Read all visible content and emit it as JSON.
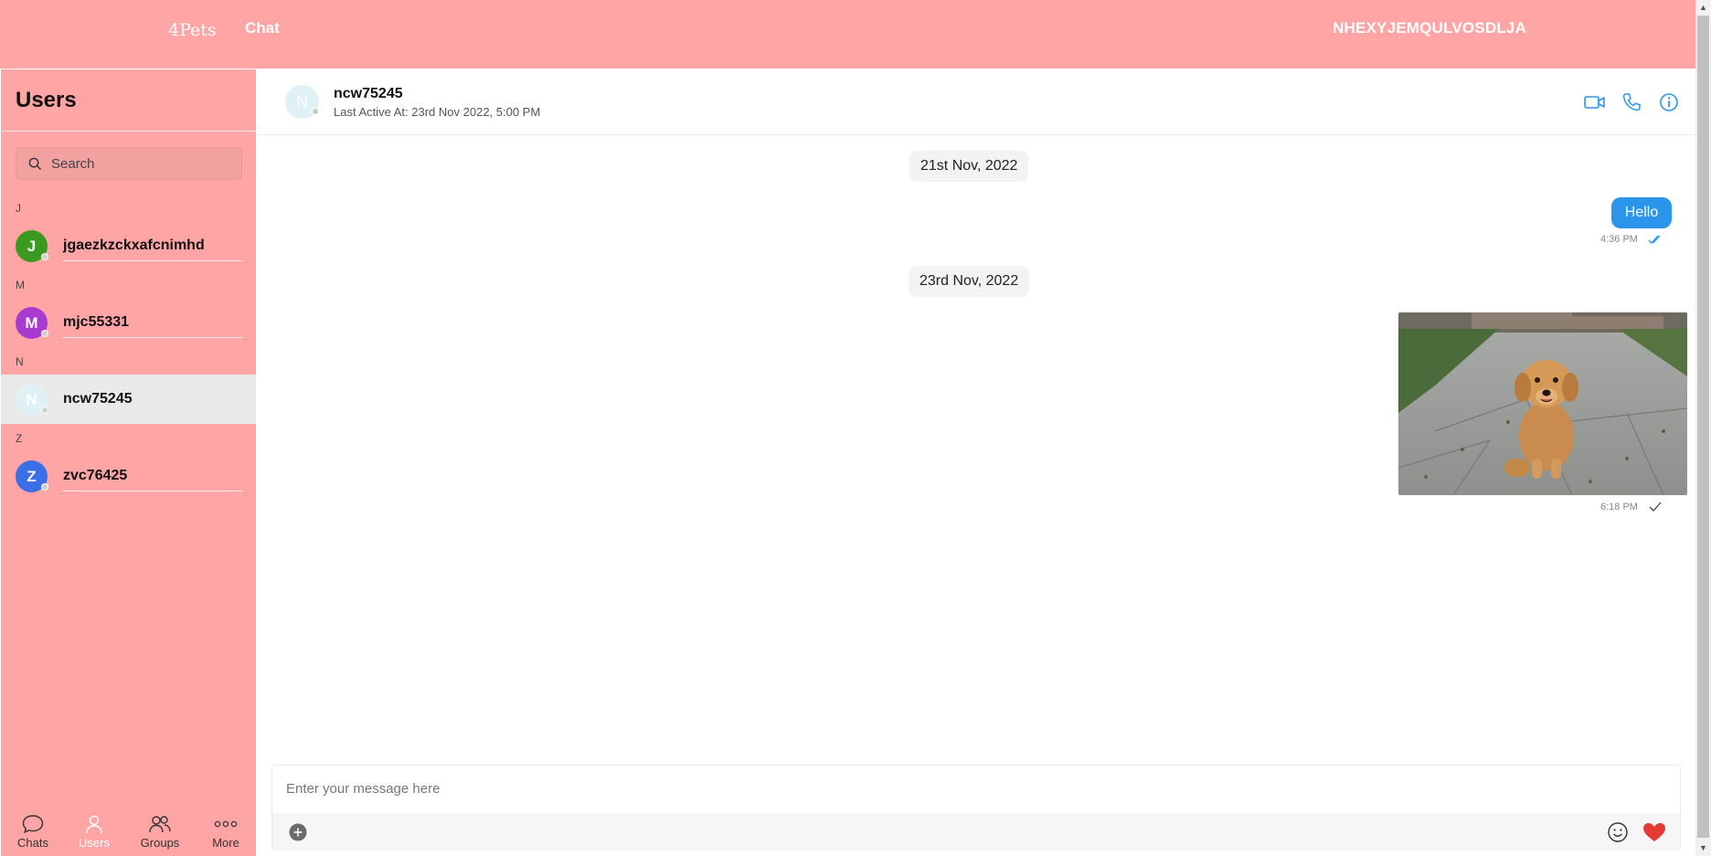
{
  "navbar": {
    "brand": "4Pets",
    "chat_link": "Chat",
    "username": "NHEXYJEMQULVOSDLJA"
  },
  "sidebar": {
    "title": "Users",
    "search_placeholder": "Search",
    "groups": [
      {
        "letter": "J",
        "user": {
          "initial": "J",
          "name": "jgaezkzckxafcnimhd",
          "color": "#3a9a1f"
        }
      },
      {
        "letter": "M",
        "user": {
          "initial": "M",
          "name": "mjc55331",
          "color": "#a93ad1"
        }
      },
      {
        "letter": "N",
        "user": {
          "initial": "N",
          "name": "ncw75245",
          "color": "#dff1f5"
        }
      },
      {
        "letter": "Z",
        "user": {
          "initial": "Z",
          "name": "zvc76425",
          "color": "#3a6fe8"
        }
      }
    ],
    "bottom_nav": [
      {
        "label": "Chats",
        "icon": "chat-bubble-icon"
      },
      {
        "label": "Users",
        "icon": "user-icon",
        "active": true
      },
      {
        "label": "Groups",
        "icon": "group-icon"
      },
      {
        "label": "More",
        "icon": "more-dots-icon"
      }
    ]
  },
  "chat": {
    "contact_initial": "N",
    "contact_name": "ncw75245",
    "last_active": "Last Active At: 23rd Nov 2022, 5:00 PM",
    "header_icons": [
      "video-call-icon",
      "phone-icon",
      "info-icon"
    ],
    "messages": [
      {
        "date": "21st Nov, 2022",
        "text": "Hello",
        "time": "4:36 PM",
        "status": "read"
      },
      {
        "date": "23rd Nov, 2022",
        "image": "puppy-photo",
        "time": "6:18 PM",
        "status": "sent"
      }
    ],
    "composer_placeholder": "Enter your message here"
  },
  "colors": {
    "primary": "#ffa5a5",
    "accent": "#2b95ec",
    "heart": "#e53935"
  }
}
